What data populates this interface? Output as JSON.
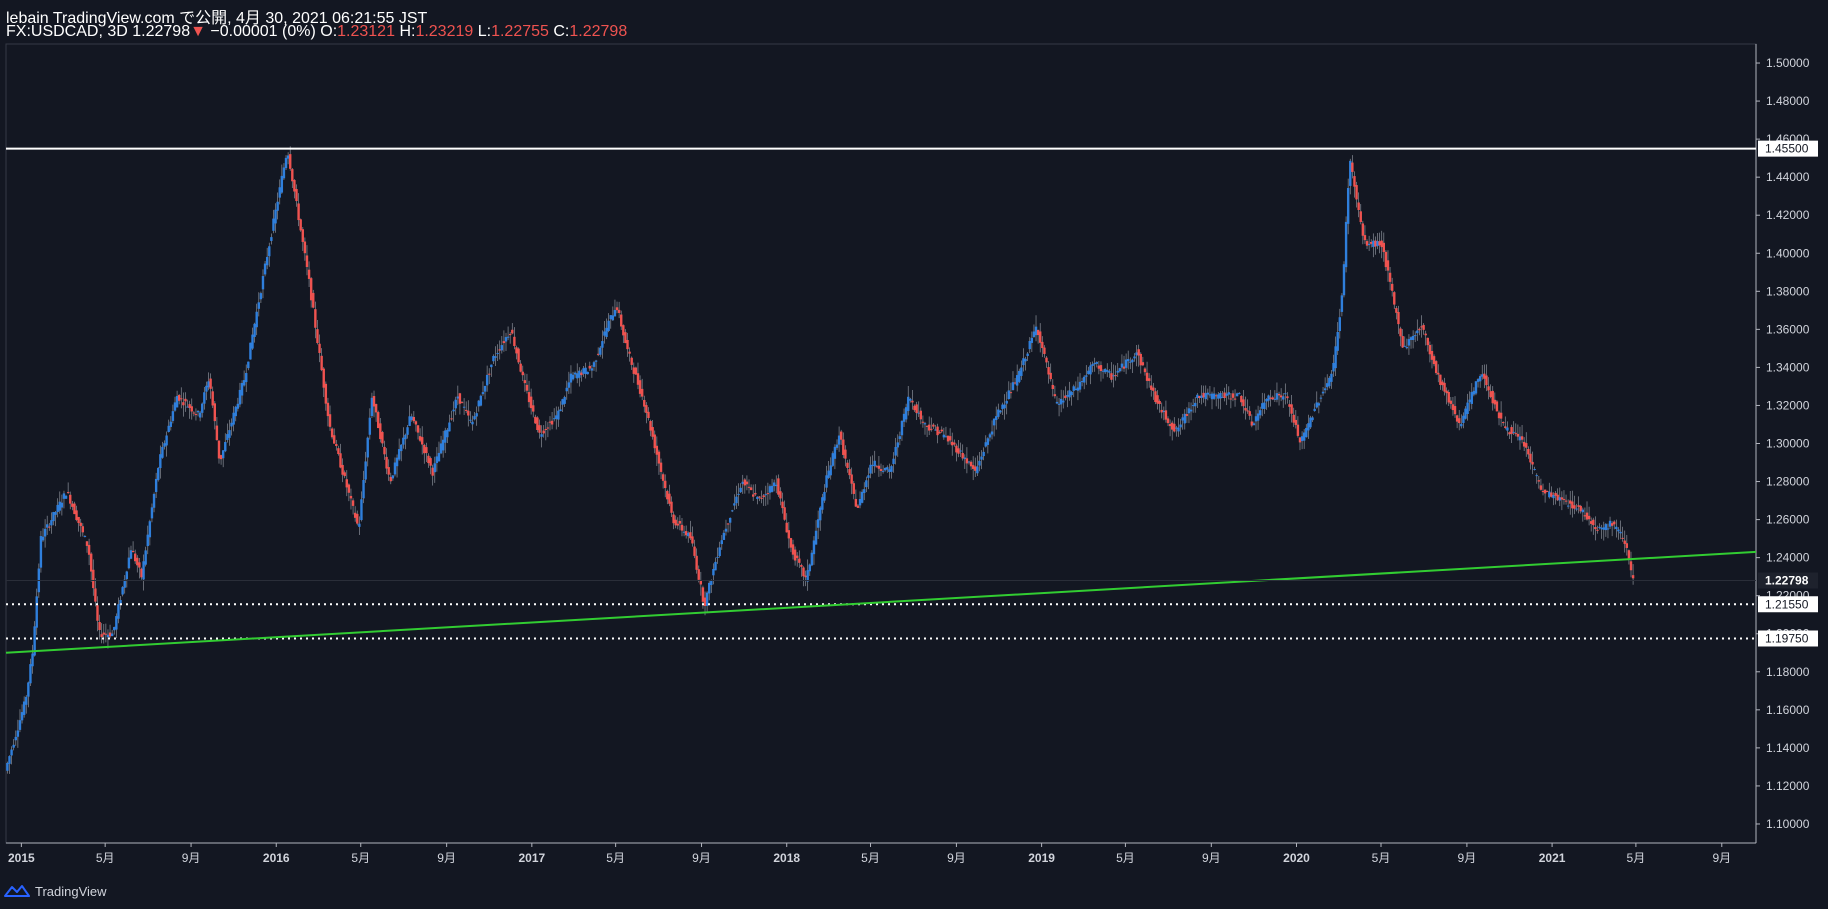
{
  "header": {
    "published_line": "lebain TradingView.com で公開, 4月 30, 2021 06:21:55 JST",
    "symbol": "FX:USDCAD, 3D",
    "last": "1.22798",
    "down_arrow": "▼",
    "change": "−0.00001 (0%)",
    "o_label": "O:",
    "o_value": "1.23121",
    "h_label": "H:",
    "h_value": "1.23219",
    "l_label": "L:",
    "l_value": "1.22755",
    "c_label": "C:",
    "c_value": "1.22798"
  },
  "footer": {
    "brand": "TradingView",
    "logo_icon": "tradingview-logo-icon"
  },
  "colors": {
    "background": "#131722",
    "up": "#2f7fdc",
    "down": "#ef5350",
    "resistance": "#ffffff",
    "trendline": "#32cd32",
    "support": "#ffffff",
    "axis_text": "#d1d4dc"
  },
  "chart_data": {
    "type": "candlestick",
    "timeframe": "3D",
    "ylim": [
      1.09,
      1.51
    ],
    "yticks": [
      "1.10000",
      "1.12000",
      "1.14000",
      "1.16000",
      "1.18000",
      "1.20000",
      "1.22000",
      "1.24000",
      "1.26000",
      "1.28000",
      "1.30000",
      "1.32000",
      "1.34000",
      "1.36000",
      "1.38000",
      "1.40000",
      "1.42000",
      "1.44000",
      "1.46000",
      "1.48000",
      "1.50000"
    ],
    "xlim": [
      "2014-12-10",
      "2021-10-20"
    ],
    "xticks": [
      {
        "date": "2015-01-01",
        "label": "2015"
      },
      {
        "date": "2015-05-01",
        "label": "5月"
      },
      {
        "date": "2015-09-01",
        "label": "9月"
      },
      {
        "date": "2016-01-01",
        "label": "2016"
      },
      {
        "date": "2016-05-01",
        "label": "5月"
      },
      {
        "date": "2016-09-01",
        "label": "9月"
      },
      {
        "date": "2017-01-01",
        "label": "2017"
      },
      {
        "date": "2017-05-01",
        "label": "5月"
      },
      {
        "date": "2017-09-01",
        "label": "9月"
      },
      {
        "date": "2018-01-01",
        "label": "2018"
      },
      {
        "date": "2018-05-01",
        "label": "5月"
      },
      {
        "date": "2018-09-01",
        "label": "9月"
      },
      {
        "date": "2019-01-01",
        "label": "2019"
      },
      {
        "date": "2019-05-01",
        "label": "5月"
      },
      {
        "date": "2019-09-01",
        "label": "9月"
      },
      {
        "date": "2020-01-01",
        "label": "2020"
      },
      {
        "date": "2020-05-01",
        "label": "5月"
      },
      {
        "date": "2020-09-01",
        "label": "9月"
      },
      {
        "date": "2021-01-01",
        "label": "2021"
      },
      {
        "date": "2021-05-01",
        "label": "5月"
      },
      {
        "date": "2021-09-01",
        "label": "9月"
      }
    ],
    "price_path": [
      [
        "2014-12-12",
        1.128
      ],
      [
        "2015-01-10",
        1.165
      ],
      [
        "2015-01-20",
        1.19
      ],
      [
        "2015-02-01",
        1.25
      ],
      [
        "2015-03-10",
        1.275
      ],
      [
        "2015-04-10",
        1.245
      ],
      [
        "2015-04-25",
        1.2
      ],
      [
        "2015-05-15",
        1.2
      ],
      [
        "2015-06-10",
        1.245
      ],
      [
        "2015-06-25",
        1.23
      ],
      [
        "2015-07-20",
        1.29
      ],
      [
        "2015-08-15",
        1.325
      ],
      [
        "2015-09-15",
        1.315
      ],
      [
        "2015-09-30",
        1.335
      ],
      [
        "2015-10-15",
        1.29
      ],
      [
        "2015-11-20",
        1.335
      ],
      [
        "2015-12-20",
        1.395
      ],
      [
        "2016-01-20",
        1.455
      ],
      [
        "2016-02-20",
        1.385
      ],
      [
        "2016-03-20",
        1.31
      ],
      [
        "2016-05-01",
        1.255
      ],
      [
        "2016-05-20",
        1.325
      ],
      [
        "2016-06-15",
        1.28
      ],
      [
        "2016-07-15",
        1.315
      ],
      [
        "2016-08-15",
        1.285
      ],
      [
        "2016-09-20",
        1.325
      ],
      [
        "2016-10-10",
        1.31
      ],
      [
        "2016-11-10",
        1.345
      ],
      [
        "2016-12-05",
        1.36
      ],
      [
        "2016-12-25",
        1.33
      ],
      [
        "2017-01-15",
        1.305
      ],
      [
        "2017-02-10",
        1.315
      ],
      [
        "2017-03-01",
        1.335
      ],
      [
        "2017-04-01",
        1.34
      ],
      [
        "2017-04-20",
        1.36
      ],
      [
        "2017-05-05",
        1.373
      ],
      [
        "2017-05-20",
        1.35
      ],
      [
        "2017-06-15",
        1.32
      ],
      [
        "2017-07-25",
        1.26
      ],
      [
        "2017-08-20",
        1.25
      ],
      [
        "2017-09-08",
        1.215
      ],
      [
        "2017-10-01",
        1.248
      ],
      [
        "2017-11-01",
        1.28
      ],
      [
        "2017-11-25",
        1.27
      ],
      [
        "2017-12-20",
        1.28
      ],
      [
        "2018-01-10",
        1.245
      ],
      [
        "2018-02-01",
        1.228
      ],
      [
        "2018-03-01",
        1.28
      ],
      [
        "2018-03-20",
        1.305
      ],
      [
        "2018-04-15",
        1.265
      ],
      [
        "2018-05-05",
        1.29
      ],
      [
        "2018-06-01",
        1.285
      ],
      [
        "2018-06-28",
        1.325
      ],
      [
        "2018-07-20",
        1.31
      ],
      [
        "2018-08-15",
        1.305
      ],
      [
        "2018-09-10",
        1.295
      ],
      [
        "2018-10-01",
        1.285
      ],
      [
        "2018-11-01",
        1.315
      ],
      [
        "2018-12-01",
        1.335
      ],
      [
        "2018-12-28",
        1.362
      ],
      [
        "2019-01-25",
        1.32
      ],
      [
        "2019-02-25",
        1.33
      ],
      [
        "2019-03-20",
        1.342
      ],
      [
        "2019-04-15",
        1.335
      ],
      [
        "2019-05-20",
        1.348
      ],
      [
        "2019-06-20",
        1.32
      ],
      [
        "2019-07-15",
        1.306
      ],
      [
        "2019-08-15",
        1.325
      ],
      [
        "2019-09-15",
        1.325
      ],
      [
        "2019-10-15",
        1.325
      ],
      [
        "2019-11-01",
        1.31
      ],
      [
        "2019-11-25",
        1.325
      ],
      [
        "2019-12-20",
        1.325
      ],
      [
        "2020-01-10",
        1.3
      ],
      [
        "2020-02-01",
        1.32
      ],
      [
        "2020-02-25",
        1.338
      ],
      [
        "2020-03-10",
        1.38
      ],
      [
        "2020-03-20",
        1.45
      ],
      [
        "2020-04-10",
        1.405
      ],
      [
        "2020-05-05",
        1.405
      ],
      [
        "2020-06-05",
        1.35
      ],
      [
        "2020-07-01",
        1.362
      ],
      [
        "2020-07-25",
        1.335
      ],
      [
        "2020-08-25",
        1.31
      ],
      [
        "2020-09-25",
        1.338
      ],
      [
        "2020-10-25",
        1.31
      ],
      [
        "2020-11-25",
        1.3
      ],
      [
        "2020-12-20",
        1.275
      ],
      [
        "2021-01-20",
        1.27
      ],
      [
        "2021-02-15",
        1.265
      ],
      [
        "2021-03-10",
        1.255
      ],
      [
        "2021-04-01",
        1.258
      ],
      [
        "2021-04-20",
        1.248
      ],
      [
        "2021-04-29",
        1.228
      ]
    ],
    "last_price": 1.22798,
    "last_price_label": "1.22798",
    "resistance": {
      "price": 1.455,
      "label": "1.45500"
    },
    "supports": [
      {
        "price": 1.2155,
        "label": "1.21550"
      },
      {
        "price": 1.1975,
        "label": "1.19750"
      }
    ],
    "trendline": [
      [
        "2014-12-10",
        1.19
      ],
      [
        "2021-10-20",
        1.243
      ]
    ],
    "grid": false
  }
}
